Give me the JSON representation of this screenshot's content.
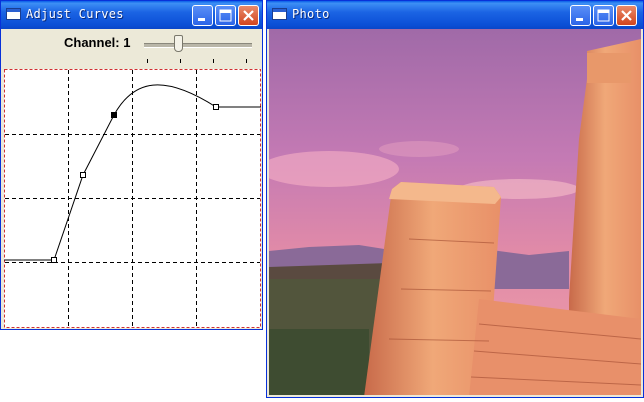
{
  "curves_window": {
    "title": "Adjust Curves",
    "channel_label": "Channel: 1",
    "channel_slider_value": 0.32
  },
  "photo_window": {
    "title": "Photo"
  },
  "colors": {
    "titlebar": "#0b4fd6",
    "window_border": "#0831d9",
    "close_button": "#d2451e",
    "grid_border": "#d03030"
  }
}
